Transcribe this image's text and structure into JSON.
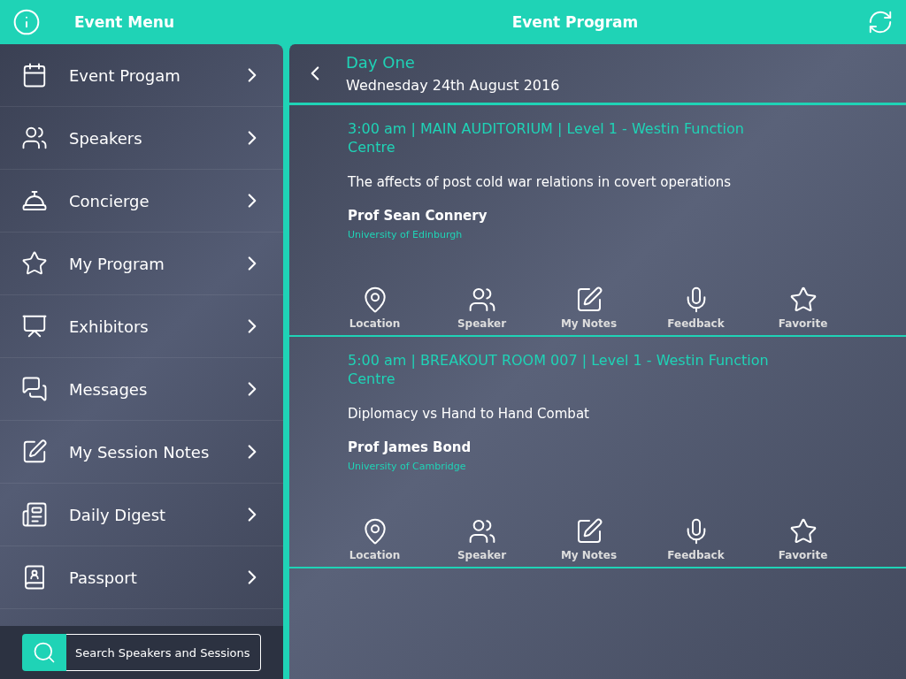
{
  "header": {
    "left_title": "Event Menu",
    "title": "Event Program"
  },
  "menu": [
    {
      "kind": "calendar",
      "label": "Event Progam"
    },
    {
      "kind": "people",
      "label": "Speakers"
    },
    {
      "kind": "bell",
      "label": "Concierge"
    },
    {
      "kind": "star",
      "label": "My Program"
    },
    {
      "kind": "easel",
      "label": "Exhibitors"
    },
    {
      "kind": "chat",
      "label": "Messages"
    },
    {
      "kind": "note",
      "label": "My Session Notes"
    },
    {
      "kind": "news",
      "label": "Daily Digest"
    },
    {
      "kind": "passport",
      "label": "Passport"
    }
  ],
  "search": {
    "placeholder": "Search Speakers and Sessions"
  },
  "day": {
    "title": "Day One",
    "date": "Wednesday 24th August 2016"
  },
  "sessions": [
    {
      "where": "3:00 am | MAIN AUDITORIUM | Level 1 - Westin Function Centre",
      "title": "The affects of post cold war relations in covert operations",
      "speaker": "Prof Sean Connery",
      "affiliation": "University of Edinburgh",
      "actions": [
        {
          "kind": "pin",
          "label": "Location"
        },
        {
          "kind": "people",
          "label": "Speaker"
        },
        {
          "kind": "note",
          "label": "My Notes"
        },
        {
          "kind": "mic",
          "label": "Feedback"
        },
        {
          "kind": "star",
          "label": "Favorite"
        }
      ]
    },
    {
      "where": "5:00 am | BREAKOUT ROOM 007 | Level 1 - Westin Function Centre",
      "title": "Diplomacy vs Hand to Hand Combat",
      "speaker": "Prof James Bond",
      "affiliation": "University of Cambridge",
      "actions": [
        {
          "kind": "pin",
          "label": "Location"
        },
        {
          "kind": "people",
          "label": "Speaker"
        },
        {
          "kind": "note",
          "label": "My Notes"
        },
        {
          "kind": "mic",
          "label": "Feedback"
        },
        {
          "kind": "star",
          "label": "Favorite"
        }
      ]
    }
  ]
}
